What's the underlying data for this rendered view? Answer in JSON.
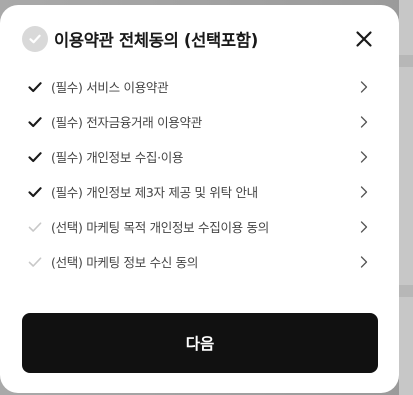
{
  "modal": {
    "title": "이용약관 전체동의 (선택포함)",
    "all_checked": false,
    "next_label": "다음"
  },
  "terms": [
    {
      "label": "(필수) 서비스 이용약관",
      "checked": true
    },
    {
      "label": "(필수) 전자금융거래 이용약관",
      "checked": true
    },
    {
      "label": "(필수) 개인정보 수집·이용",
      "checked": true
    },
    {
      "label": "(필수) 개인정보 제3자 제공 및 위탁 안내",
      "checked": true
    },
    {
      "label": "(선택) 마케팅 목적 개인정보 수집이용 동의",
      "checked": false
    },
    {
      "label": "(선택) 마케팅 정보 수신 동의",
      "checked": false
    }
  ],
  "colors": {
    "checked": "#1a1a1a",
    "unchecked": "#c8c8c8",
    "chevron": "#555555",
    "button_bg": "#111111",
    "button_text": "#ffffff"
  },
  "icons": {
    "all_check": "check-circle-icon",
    "close": "close-icon",
    "item_check": "check-icon",
    "chevron": "chevron-right-icon"
  }
}
